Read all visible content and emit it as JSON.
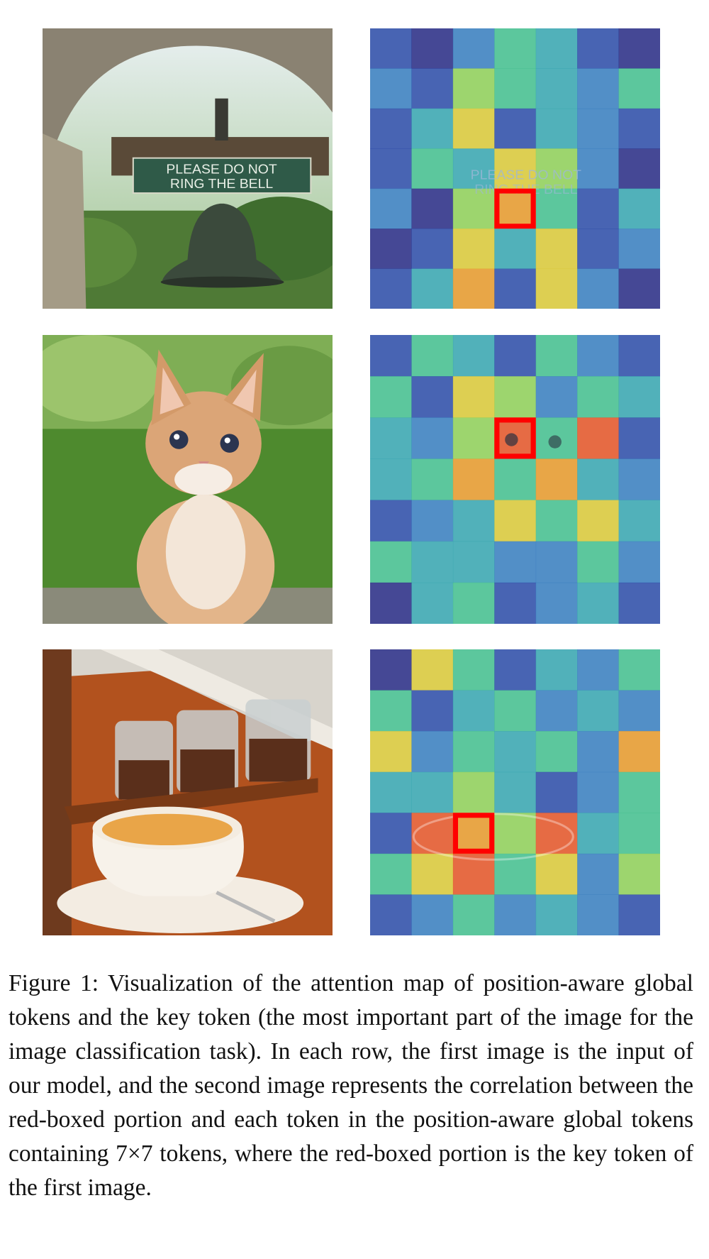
{
  "figure": {
    "panels": [
      {
        "row": 1,
        "kind": "input",
        "icon": "bell-photo",
        "sign_line1": "PLEASE DO NOT",
        "sign_line2": "RING THE BELL"
      },
      {
        "row": 1,
        "kind": "attention-map",
        "key_token": {
          "row": 5,
          "col": 4
        }
      },
      {
        "row": 2,
        "kind": "input",
        "icon": "kitten-photo"
      },
      {
        "row": 2,
        "kind": "attention-map",
        "key_token": {
          "row": 3,
          "col": 4
        }
      },
      {
        "row": 3,
        "kind": "input",
        "icon": "coffee-cup-photo"
      },
      {
        "row": 3,
        "kind": "attention-map",
        "key_token": {
          "row": 5,
          "col": 3
        }
      }
    ],
    "grid": "7x7",
    "key_box_color": "#ff0000",
    "caption": {
      "label": "Figure 1:",
      "text": "Visualization of the attention map of position-aware global tokens and the key token (the most important part of the image for the image classification task). In each row, the first image is the input of our model, and the second image represents the correlation between the red-boxed portion and each token in the position-aware global tokens containing 7×7 tokens, where the red-boxed portion is the key token of the first image."
    }
  }
}
